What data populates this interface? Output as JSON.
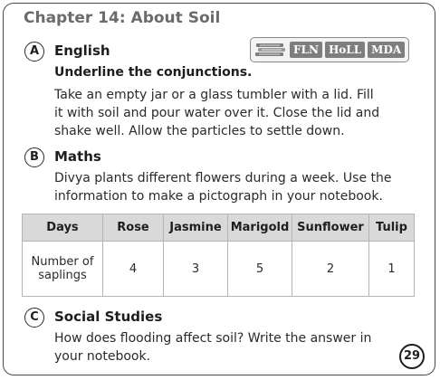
{
  "chapter_title": "Chapter 14: About Soil",
  "badges": [
    "FLN",
    "HoLL",
    "MDA"
  ],
  "sections": [
    {
      "letter": "A",
      "title": "English",
      "instruction": "Underline the conjunctions.",
      "lines": [
        "Take an empty jar or a glass tumbler with a lid. Fill",
        "it with soil and pour water over it. Close the lid and",
        "shake well. Allow the particles to settle down."
      ]
    },
    {
      "letter": "B",
      "title": "Maths",
      "lines": [
        "Divya plants different flowers during a week. Use the",
        "information to make a pictograph in your notebook."
      ]
    },
    {
      "letter": "C",
      "title": "Social Studies",
      "lines": [
        "How does flooding affect soil? Write the answer in",
        "your notebook."
      ]
    }
  ],
  "table": {
    "headers": [
      "Days",
      "Rose",
      "Jasmine",
      "Marigold",
      "Sunflower",
      "Tulip"
    ],
    "row_label_lines": [
      "Number of",
      "saplings"
    ],
    "values": [
      "4",
      "3",
      "5",
      "2",
      "1"
    ]
  },
  "page_number": "29",
  "icons": {
    "badge_decoration": "book-stack-icon"
  }
}
